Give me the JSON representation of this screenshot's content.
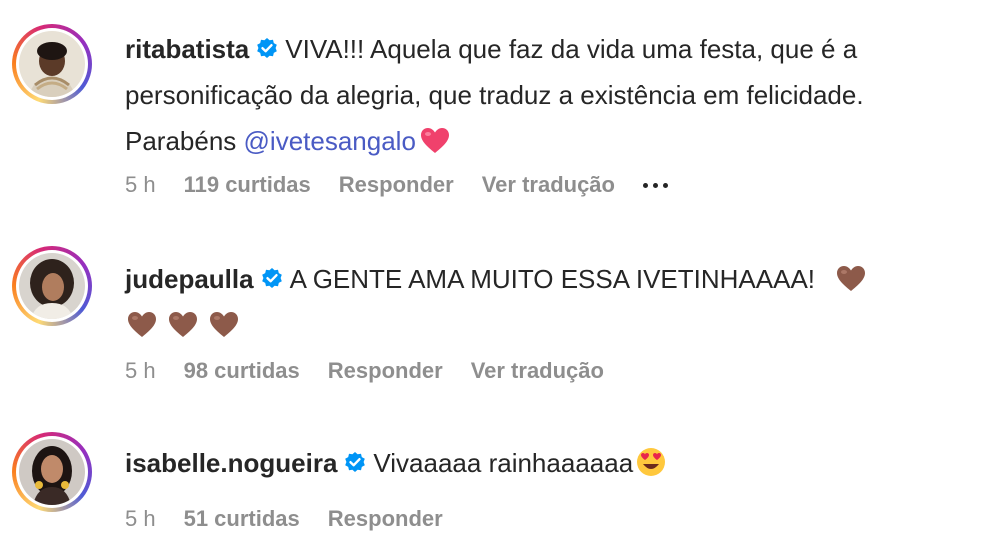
{
  "comments": [
    {
      "username": "ritabatista",
      "text_before": "VIVA!!! Aquela que faz da vida uma festa, que é a personificação da alegria, que traduz a existência em felicidade. Parabéns ",
      "mention": "@ivetesangalo",
      "emoji": "heart-pink",
      "time": "5 h",
      "likes": "119 curtidas",
      "reply": "Responder",
      "translate": "Ver tradução"
    },
    {
      "username": "judepaulla",
      "text": "A GENTE AMA MUITO ESSA IVETINHAAAA!",
      "emoji": "heart-brown",
      "time": "5 h",
      "likes": "98 curtidas",
      "reply": "Responder",
      "translate": "Ver tradução"
    },
    {
      "username": "isabelle.nogueira",
      "text": "Vivaaaaa rainhaaaaaa",
      "emoji": "heart-eyes-face",
      "time": "5 h",
      "likes": "51 curtidas",
      "reply": "Responder"
    }
  ],
  "colors": {
    "verified": "#0095f6",
    "mention": "#4a5bc4",
    "meta": "#8e8e8e",
    "heart_pink": "#f0416c",
    "heart_brown": "#8d5a4a"
  },
  "icons": {
    "verified": "verified-badge-icon",
    "more": "more-options-icon"
  }
}
